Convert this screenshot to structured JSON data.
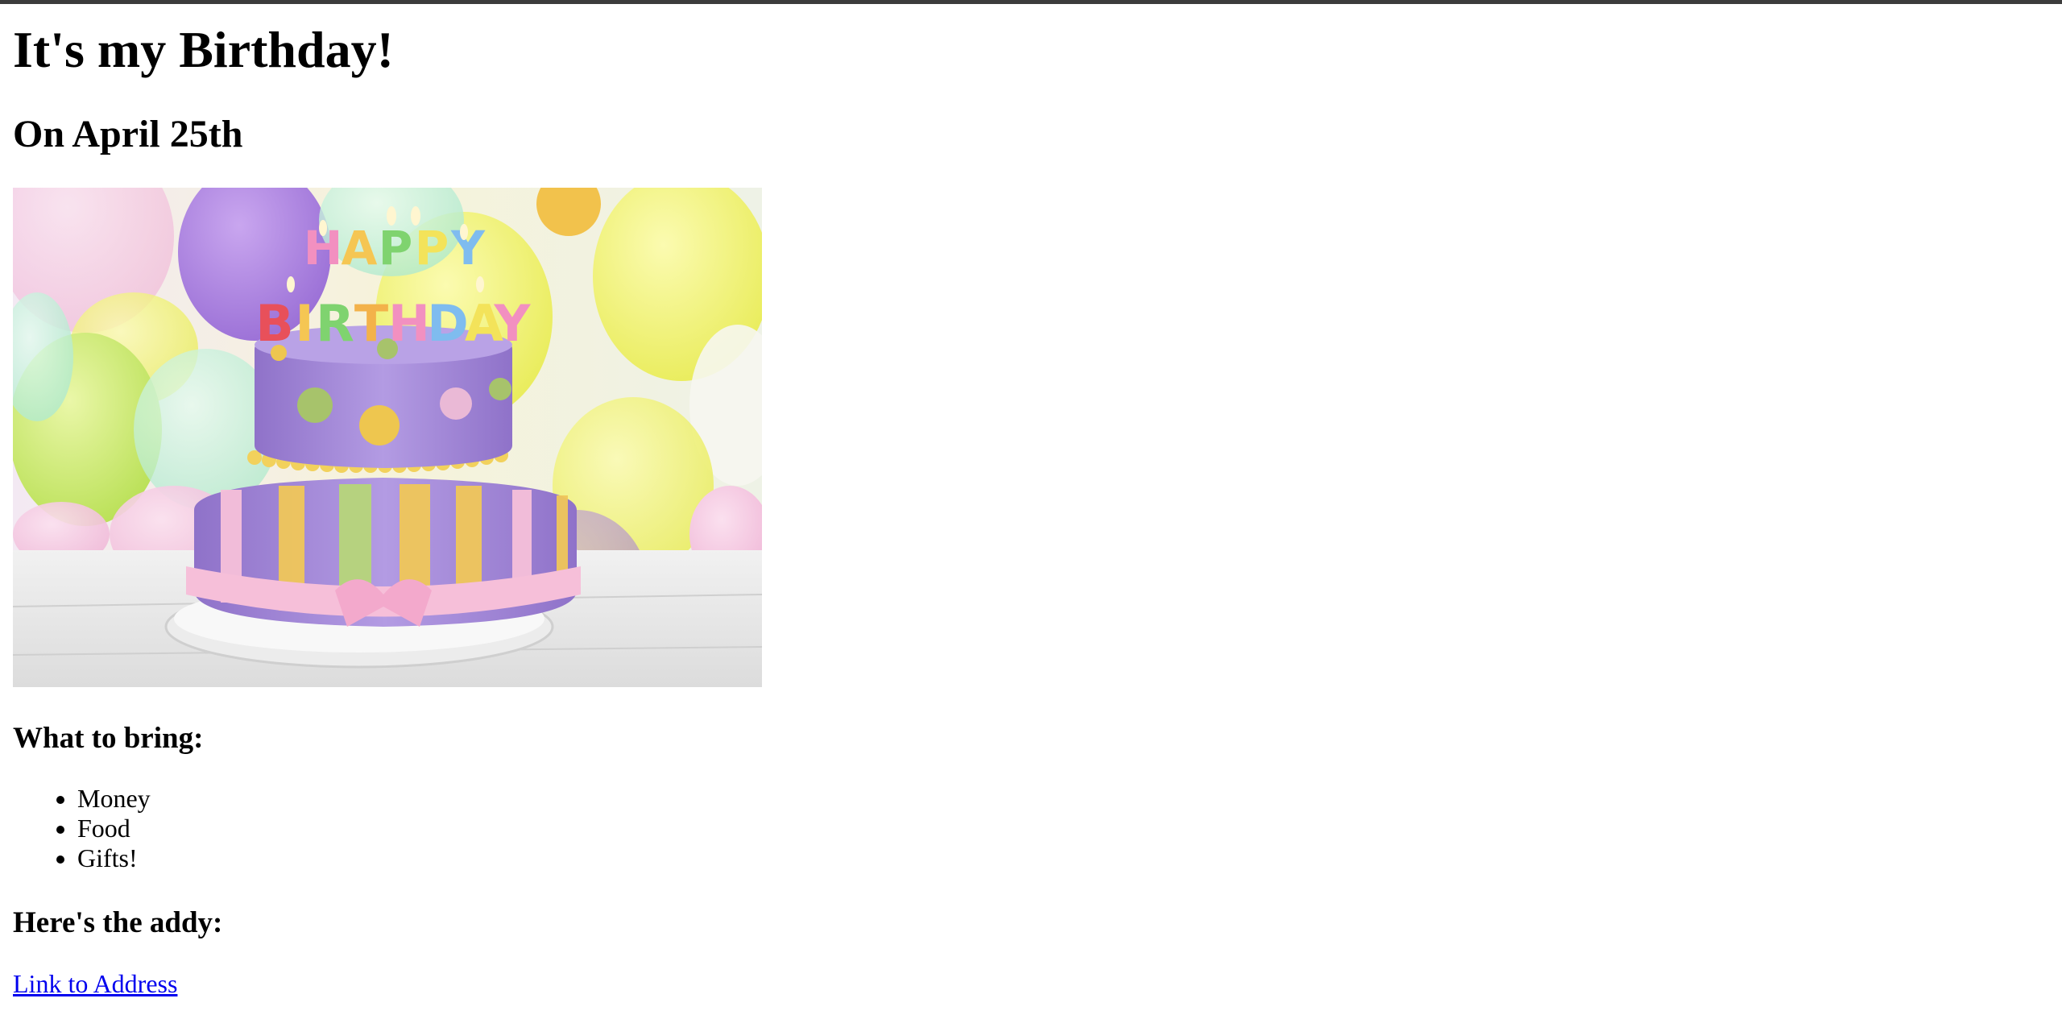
{
  "header": {
    "title": "It's my Birthday!",
    "date": "On April 25th"
  },
  "image": {
    "subject": "two-tier purple birthday cake with pastel stripes, candles spelling HAPPY BIRTHDAY, pastel balloons in background",
    "candle_text": "HAPPY BIRTHDAY"
  },
  "bring": {
    "heading": "What to bring:",
    "items": [
      "Money",
      "Food",
      "Gifts!"
    ]
  },
  "address": {
    "heading": "Here's the addy:",
    "link_label": "Link to Address"
  },
  "colors": {
    "link": "#0000ee",
    "text": "#000000",
    "cake_purple": "#a98fd6",
    "background": "#ffffff"
  }
}
